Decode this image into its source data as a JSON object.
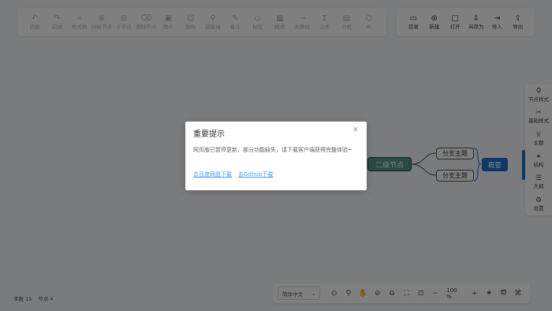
{
  "toolbar_left": [
    {
      "icon": "↶",
      "label": "回退"
    },
    {
      "icon": "↷",
      "label": "前进"
    },
    {
      "icon": "⌗",
      "label": "格式刷"
    },
    {
      "icon": "⊕",
      "label": "同级节点"
    },
    {
      "icon": "⊞",
      "label": "子节点"
    },
    {
      "icon": "⌫",
      "label": "删除节点"
    },
    {
      "icon": "▣",
      "label": "图片"
    },
    {
      "icon": "☺",
      "label": "图标"
    },
    {
      "icon": "⚲",
      "label": "超链接"
    },
    {
      "icon": "✎",
      "label": "备注"
    },
    {
      "icon": "◇",
      "label": "标签"
    },
    {
      "icon": "▦",
      "label": "概要"
    },
    {
      "icon": "⊸",
      "label": "关联线"
    },
    {
      "icon": "Σ",
      "label": "公式"
    },
    {
      "icon": "▤",
      "label": "外框"
    },
    {
      "icon": "⌬",
      "label": "AI"
    }
  ],
  "toolbar_right": [
    {
      "icon": "▭",
      "label": "目录"
    },
    {
      "icon": "⊕",
      "label": "新建"
    },
    {
      "icon": "□",
      "label": "打开"
    },
    {
      "icon": "⇓",
      "label": "另存为"
    },
    {
      "icon": "⇥",
      "label": "导入"
    },
    {
      "icon": "⇪",
      "label": "导出"
    }
  ],
  "sidebar": [
    {
      "icon": "⚲",
      "label": "节点样式"
    },
    {
      "icon": "✂",
      "label": "基础样式"
    },
    {
      "icon": "♕",
      "label": "主题"
    },
    {
      "icon": "⚭",
      "label": "结构"
    },
    {
      "icon": "☰",
      "label": "大纲"
    },
    {
      "icon": "⚙",
      "label": "设置"
    }
  ],
  "mindmap": {
    "root": "二级节点",
    "branch_a": "分支主题",
    "branch_b": "分支主题",
    "summary": "概要"
  },
  "status": {
    "word_count": "字数 15",
    "node_count": "节点 4"
  },
  "bottom_bar": {
    "language": "简体中文",
    "zoom": "100 %"
  },
  "dialog": {
    "title": "重要提示",
    "body": "网页版已暂停更新，部分功能缺失，请下载客户端获得完整体验~",
    "link_baidu": "去百度网盘下载",
    "link_github": "去Github下载"
  }
}
